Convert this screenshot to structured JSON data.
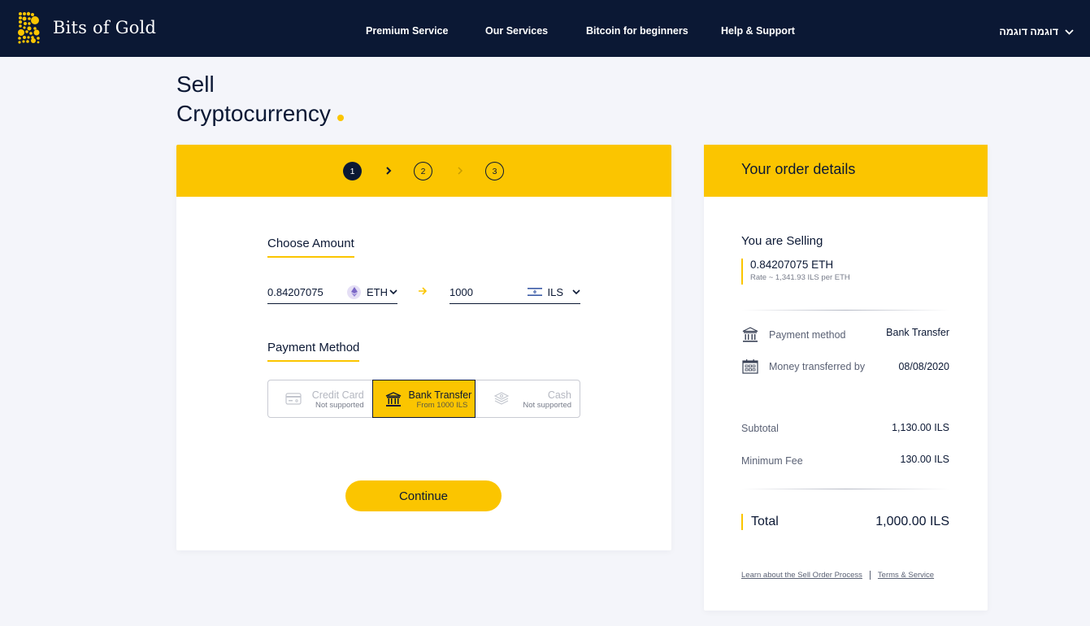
{
  "header": {
    "brand": "Bits of Gold",
    "nav": [
      {
        "label": "Premium Service"
      },
      {
        "label": "Our Services"
      },
      {
        "label": "Bitcoin for beginners"
      },
      {
        "label": "Help & Support"
      }
    ],
    "user_menu_label": "דוגמה דוגמה",
    "user_menu_icon": "chevron-down-icon"
  },
  "page": {
    "title_line1": "Sell",
    "title_line2": "Cryptocurrency"
  },
  "stepper": {
    "steps": [
      {
        "number": "1",
        "state": "active"
      },
      {
        "number": "2",
        "state": "inactive"
      },
      {
        "number": "3",
        "state": "inactive"
      }
    ]
  },
  "amount": {
    "section_title": "Choose Amount",
    "crypto_value": "0.84207075",
    "crypto_currency": "ETH",
    "crypto_icon": "ethereum-icon",
    "fiat_value": "1000",
    "fiat_currency": "ILS",
    "fiat_icon": "israel-flag-icon",
    "arrow_icon": "arrow-right-icon"
  },
  "payment": {
    "section_title": "Payment Method",
    "options": [
      {
        "name": "Credit Card",
        "sub": "Not supported",
        "icon": "credit-card-icon",
        "state": "disabled"
      },
      {
        "name": "Bank Transfer",
        "sub": "From 1000 ILS",
        "icon": "bank-icon",
        "state": "selected"
      },
      {
        "name": "Cash",
        "sub": "Not supported",
        "icon": "cash-icon",
        "state": "disabled"
      }
    ]
  },
  "continue_label": "Continue",
  "order": {
    "title": "Your order details",
    "selling_title": "You are Selling",
    "selling_amount": "0.84207075 ETH",
    "rate": "Rate ~ 1,341.93 ILS per ETH",
    "payment_method_label": "Payment method",
    "payment_method_value": "Bank Transfer",
    "transfer_label": "Money transferred by",
    "transfer_value": "08/08/2020",
    "subtotal_label": "Subtotal",
    "subtotal_value": "1,130.00 ILS",
    "fee_label": "Minimum Fee",
    "fee_value": "130.00 ILS",
    "total_label": "Total",
    "total_value": "1,000.00 ILS",
    "link_learn": "Learn about the Sell Order Process",
    "link_terms": "Terms & Service"
  },
  "colors": {
    "navy": "#0b1834",
    "gold": "#fbc500",
    "background": "#f4f5fa"
  }
}
